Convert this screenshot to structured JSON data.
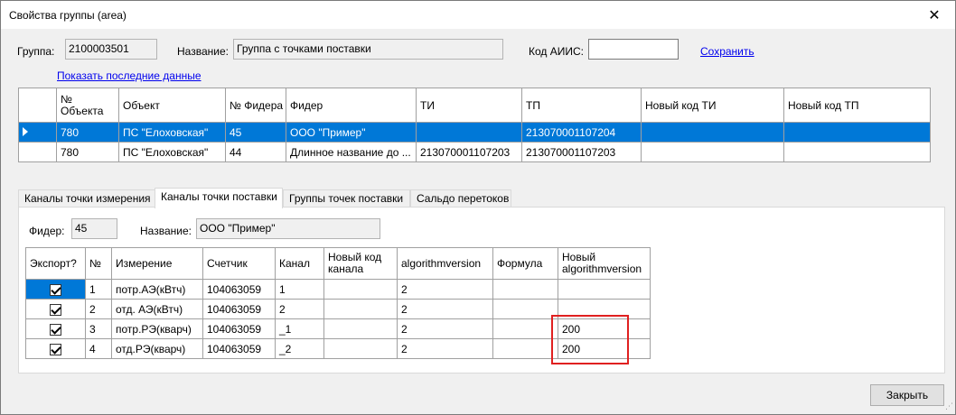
{
  "window": {
    "title": "Свойства группы (area)",
    "close_glyph": "✕"
  },
  "header": {
    "group_label": "Группа:",
    "group_value": "2100003501",
    "name_label": "Название:",
    "name_value": "Группа с точками поставки",
    "aiis_label": "Код АИИС:",
    "aiis_value": "",
    "save_link": "Сохранить",
    "show_last_link": "Показать последние данные"
  },
  "top_grid": {
    "columns": [
      "№ Объекта",
      "Объект",
      "№ Фидера",
      "Фидер",
      "ТИ",
      "ТП",
      "Новый код ТИ",
      "Новый код ТП"
    ],
    "rows": [
      {
        "selected": true,
        "cells": [
          "780",
          "ПС \"Елоховская\"",
          "45",
          "ООО \"Пример\"",
          "",
          "213070001107204",
          "",
          ""
        ]
      },
      {
        "selected": false,
        "cells": [
          "780",
          "ПС \"Елоховская\"",
          "44",
          "Длинное название до ...",
          "213070001107203",
          "213070001107203",
          "",
          ""
        ]
      }
    ]
  },
  "tabs": [
    "Каналы точки измерения",
    "Каналы точки поставки",
    "Группы точек поставки",
    "Сальдо перетоков"
  ],
  "active_tab": 1,
  "feeder": {
    "feeder_label": "Фидер:",
    "feeder_value": "45",
    "name_label": "Название:",
    "name_value": "ООО \"Пример\""
  },
  "channels_grid": {
    "columns": [
      "Экспорт?",
      "№",
      "Измерение",
      "Счетчик",
      "Канал",
      "Новый код канала",
      "algorithmversion",
      "Формула",
      "Новый algorithmversion"
    ],
    "rows": [
      {
        "export": true,
        "cells": [
          "1",
          "потр.АЭ(кВтч)",
          "104063059",
          "1",
          "",
          "2",
          "",
          ""
        ]
      },
      {
        "export": true,
        "cells": [
          "2",
          "отд. АЭ(кВтч)",
          "104063059",
          "2",
          "",
          "2",
          "",
          ""
        ]
      },
      {
        "export": true,
        "cells": [
          "3",
          "потр.РЭ(кварч)",
          "104063059",
          "_1",
          "",
          "2",
          "",
          "200"
        ]
      },
      {
        "export": true,
        "cells": [
          "4",
          "отд.РЭ(кварч)",
          "104063059",
          "_2",
          "",
          "2",
          "",
          "200"
        ]
      }
    ]
  },
  "footer": {
    "close_button": "Закрыть"
  },
  "colors": {
    "selection": "#0078d7",
    "highlight_box": "#e02020"
  }
}
